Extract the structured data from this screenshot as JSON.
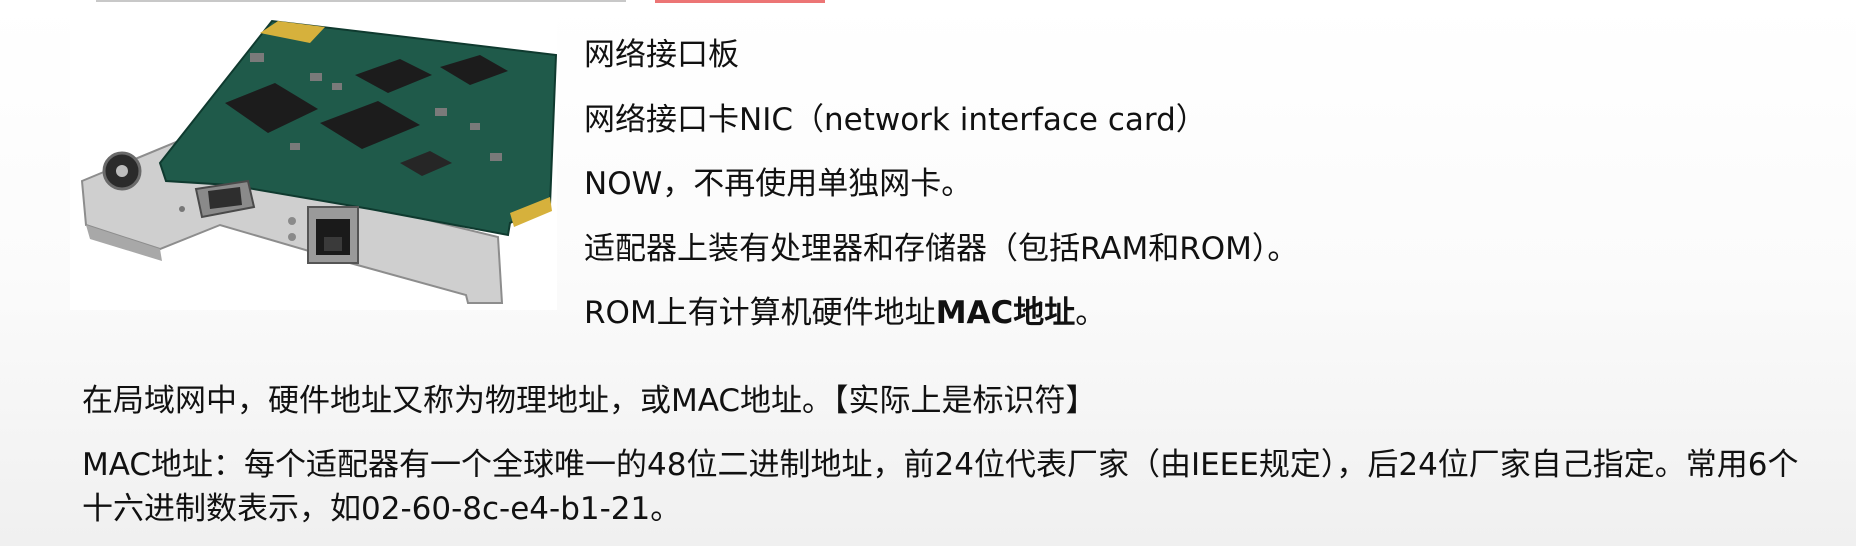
{
  "figure": {
    "icon": "network-interface-card-photo",
    "colors": {
      "pcb": "#1f5a4a",
      "gold": "#d6b13c",
      "bracket": "#c9c9c9",
      "chip": "#1c1c1c"
    }
  },
  "card_lines": [
    {
      "text": "网络接口板"
    },
    {
      "text": "网络接口卡NIC（network interface card）"
    },
    {
      "text": "NOW，不再使用单独网卡。"
    },
    {
      "text": "适配器上装有处理器和存储器（包括RAM和ROM）。"
    },
    {
      "text": "ROM上有计算机硬件地址",
      "bold": "MAC地址",
      "suffix": "。"
    }
  ],
  "paragraphs": [
    "在局域网中，硬件地址又称为物理地址，或MAC地址。【实际上是标识符】",
    "MAC地址：每个适配器有一个全球唯一的48位二进制地址，前24位代表厂家（由IEEE规定），后24位厂家自己指定。常用6个十六进制数表示，如02-60-8c-e4-b1-21。"
  ]
}
